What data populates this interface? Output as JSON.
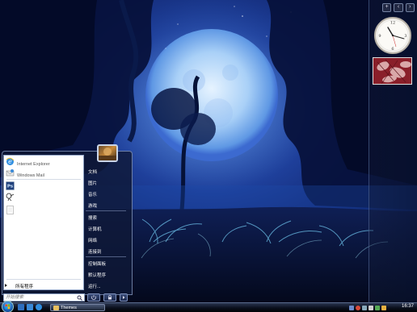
{
  "start_menu": {
    "pinned": [
      {
        "title": "Internet",
        "subtitle": "Internet Explorer",
        "icon": "ie-icon"
      },
      {
        "title": "电子邮件",
        "subtitle": "Windows Mail",
        "icon": "mail-icon"
      }
    ],
    "recent": [
      {
        "title": "Photoshop.exe",
        "icon": "photoshop-icon"
      },
      {
        "title": "E-Spline.exe",
        "icon": "espline-icon"
      },
      {
        "title": "Microsoft Office Word 2003",
        "icon": "word-icon"
      }
    ],
    "all_programs": "所有程序",
    "search_placeholder": "开始搜索",
    "right_items": [
      {
        "label": "文档",
        "name": "documents"
      },
      {
        "label": "图片",
        "name": "pictures"
      },
      {
        "label": "音乐",
        "name": "music"
      },
      {
        "label": "游戏",
        "name": "games"
      },
      {
        "label": "搜索",
        "name": "search"
      },
      {
        "label": "计算机",
        "name": "computer"
      },
      {
        "label": "网络",
        "name": "network"
      },
      {
        "label": "连接到",
        "name": "connect-to"
      },
      {
        "label": "控制面板",
        "name": "control-panel"
      },
      {
        "label": "默认程序",
        "name": "default-programs"
      },
      {
        "label": "运行...",
        "name": "run"
      }
    ]
  },
  "taskbar": {
    "task_label": "Themes",
    "clock": "16:37"
  },
  "sidebar": {
    "add_button": "+",
    "nav_prev": "‹",
    "nav_next": "›"
  },
  "colors": {
    "accent": "#1b5fb5",
    "start_menu_bg": "#0f1937"
  }
}
